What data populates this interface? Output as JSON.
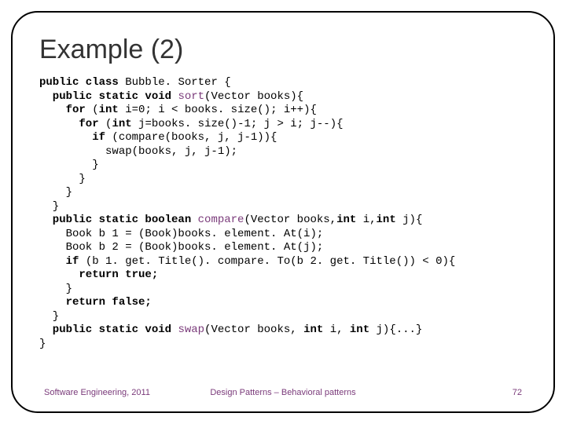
{
  "title": "Example (2)",
  "code": {
    "l1a": "public class",
    "l1b": " Bubble. Sorter {",
    "l2a": "  public static void ",
    "l2b": "sort",
    "l2c": "(Vector books){",
    "l3a": "    for",
    "l3b": " (",
    "l3c": "int",
    "l3d": " i=0; i < books. size(); i++){",
    "l4a": "      for",
    "l4b": " (",
    "l4c": "int",
    "l4d": " j=books. size()-1; j > i; j--){",
    "l5a": "        if",
    "l5b": " (compare(books, j, j-1)){",
    "l6": "          swap(books, j, j-1);",
    "l7": "        }",
    "l8": "      }",
    "l9": "    }",
    "l10": "  }",
    "l11a": "  public static boolean ",
    "l11b": "compare",
    "l11c": "(Vector books,",
    "l11d": "int",
    "l11e": " i,",
    "l11f": "int",
    "l11g": " j){",
    "l12": "    Book b 1 = (Book)books. element. At(i);",
    "l13": "    Book b 2 = (Book)books. element. At(j);",
    "l14a": "    if",
    "l14b": " (b 1. get. Title(). compare. To(b 2. get. Title()) < 0){",
    "l15a": "      return true;",
    "l16": "    }",
    "l17a": "    return false;",
    "l18": "  }",
    "l19a": "  public static void ",
    "l19b": "swap",
    "l19c": "(Vector books, ",
    "l19d": "int",
    "l19e": " i, ",
    "l19f": "int",
    "l19g": " j){...}",
    "l20": "}"
  },
  "footer": {
    "left": "Software Engineering, 2011",
    "center": "Design Patterns – Behavioral patterns",
    "right": "72"
  }
}
